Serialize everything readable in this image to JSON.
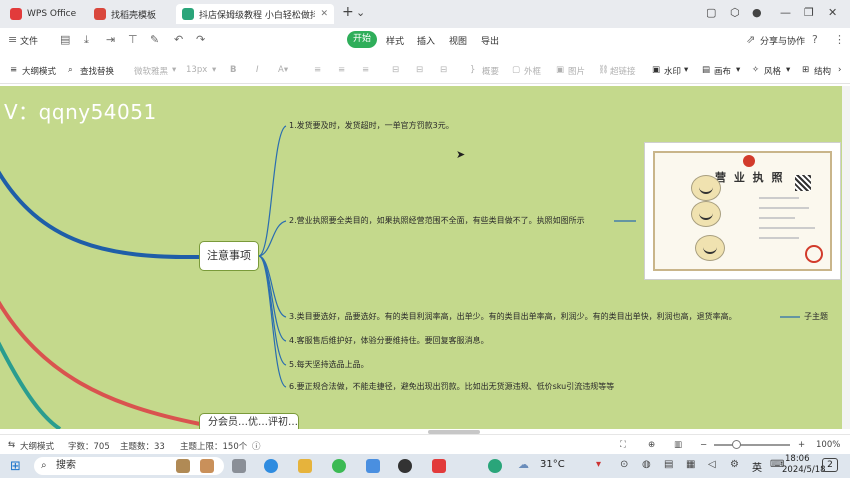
{
  "tabs": [
    {
      "label": "WPS Office",
      "active": false
    },
    {
      "label": "找稻壳模板",
      "active": false
    },
    {
      "label": "抖店保姆级教程 小白轻松做抖店.x",
      "active": true
    }
  ],
  "menubar": {
    "file": "文件",
    "tabs": [
      "开始",
      "样式",
      "插入",
      "视图",
      "导出"
    ],
    "share": "分享与协作"
  },
  "toolbar": {
    "outline_mode": "大纲模式",
    "find_replace": "查找替换",
    "font": "微软雅黑",
    "size": "13px",
    "summary": "概要",
    "frame": "外框",
    "image": "图片",
    "link": "超链接",
    "watermark": "水印",
    "canvas": "画布",
    "style": "风格",
    "structure": "结构"
  },
  "canvas": {
    "watermark": "V：qqny54051",
    "topic": "注意事项",
    "topic2": "分会员…优…评初…创",
    "leaves": [
      "1.发货要及时，发货超时，一单官方罚款3元。",
      "2.营业执照要全类目的，如果执照经营范围不全面，有些类目做不了。执照如图所示",
      "3.类目要选好，品要选好。有的类目利润率高，出单少。有的类目出单率高，利润少。有的类目出单快，利润也高，退货率高。",
      "4.客服售后维护好，体验分要维持住。要回复客服消息。",
      "5.每天坚持选品上品。",
      "6.要正规合法做，不能走捷径，避免出现出罚款。比如出无货源违规、低价sku引流违规等等"
    ],
    "subtopic": "子主题",
    "cert_title": "营 业 执 照"
  },
  "statusbar": {
    "outline_mode": "大纲模式",
    "word_count": "字数：705",
    "topic_count": "主题数：33",
    "topic_limit": "主题上限：150个",
    "zoom": "100%"
  },
  "taskbar": {
    "search": "搜索",
    "weather": "31°C",
    "ime": "英",
    "time": "18:06",
    "date": "2024/5/18",
    "notifications": "2"
  },
  "colors": {
    "canvas_bg": "#c4d98c",
    "accent_green": "#2fae5a",
    "branch_blue": "#1f5ea8",
    "branch_red": "#d9534f",
    "branch_teal": "#2a9d8f"
  }
}
